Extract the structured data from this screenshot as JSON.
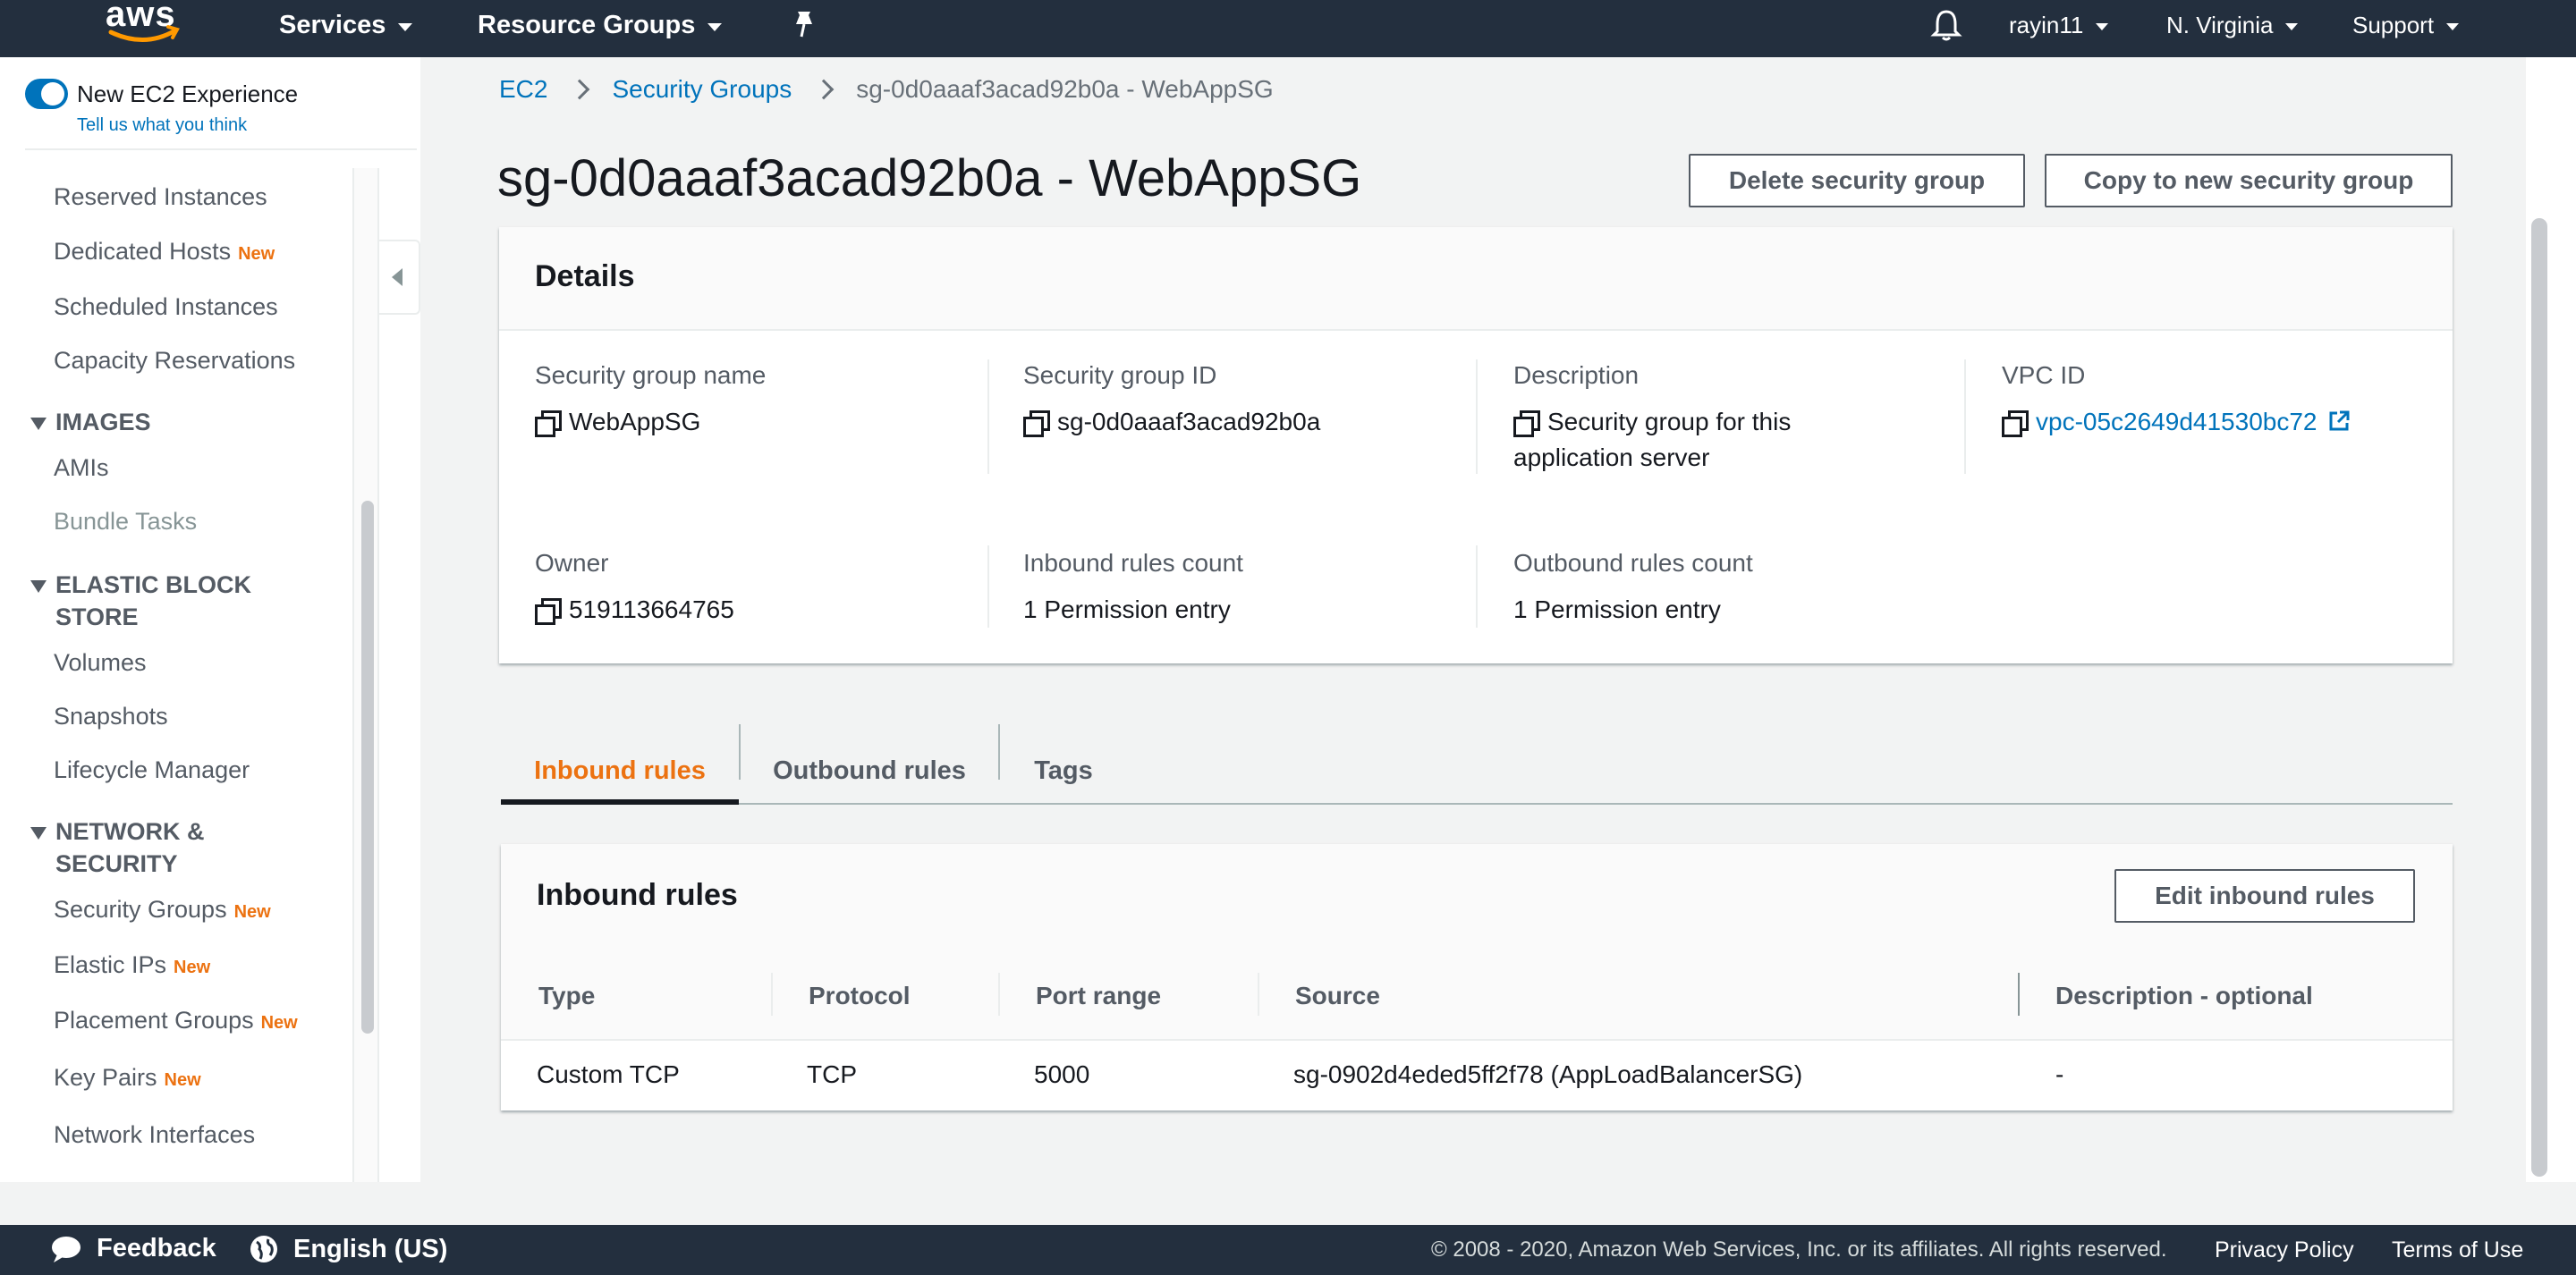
{
  "topnav": {
    "logo": "aws",
    "services": "Services",
    "resource_groups": "Resource Groups",
    "user": "rayin11",
    "region": "N. Virginia",
    "support": "Support"
  },
  "sidebar": {
    "experience_label": "New EC2 Experience",
    "experience_link": "Tell us what you think",
    "items_top": [
      {
        "label": "Reserved Instances",
        "badge": ""
      },
      {
        "label": "Dedicated Hosts",
        "badge": "New"
      },
      {
        "label": "Scheduled Instances",
        "badge": ""
      },
      {
        "label": "Capacity Reservations",
        "badge": ""
      }
    ],
    "section_images": "IMAGES",
    "images_items": [
      "AMIs",
      "Bundle Tasks"
    ],
    "section_ebs_line1": "ELASTIC BLOCK",
    "section_ebs_line2": "STORE",
    "ebs_items": [
      "Volumes",
      "Snapshots",
      "Lifecycle Manager"
    ],
    "section_net_line1": "NETWORK &",
    "section_net_line2": "SECURITY",
    "net_items": [
      {
        "label": "Security Groups",
        "badge": "New"
      },
      {
        "label": "Elastic IPs",
        "badge": "New"
      },
      {
        "label": "Placement Groups",
        "badge": "New"
      },
      {
        "label": "Key Pairs",
        "badge": "New"
      },
      {
        "label": "Network Interfaces",
        "badge": ""
      }
    ]
  },
  "breadcrumb": {
    "ec2": "EC2",
    "security_groups": "Security Groups",
    "current": "sg-0d0aaaf3acad92b0a - WebAppSG"
  },
  "page": {
    "title": "sg-0d0aaaf3acad92b0a - WebAppSG",
    "delete_button": "Delete security group",
    "copy_button": "Copy to new security group"
  },
  "details": {
    "title": "Details",
    "sg_name_label": "Security group name",
    "sg_name": "WebAppSG",
    "sg_id_label": "Security group ID",
    "sg_id": "sg-0d0aaaf3acad92b0a",
    "description_label": "Description",
    "description_line1": "Security group for this",
    "description_line2": "application server",
    "vpc_label": "VPC ID",
    "vpc_id": "vpc-05c2649d41530bc72",
    "owner_label": "Owner",
    "owner": "519113664765",
    "inbound_count_label": "Inbound rules count",
    "inbound_count": "1 Permission entry",
    "outbound_count_label": "Outbound rules count",
    "outbound_count": "1 Permission entry"
  },
  "tabs": [
    "Inbound rules",
    "Outbound rules",
    "Tags"
  ],
  "inbound": {
    "title": "Inbound rules",
    "edit_button": "Edit inbound rules",
    "columns": [
      "Type",
      "Protocol",
      "Port range",
      "Source",
      "Description - optional"
    ],
    "rows": [
      [
        "Custom TCP",
        "TCP",
        "5000",
        "sg-0902d4eded5ff2f78 (AppLoadBalancerSG)",
        "-"
      ]
    ]
  },
  "footer": {
    "feedback": "Feedback",
    "language": "English (US)",
    "copyright": "© 2008 - 2020, Amazon Web Services, Inc. or its affiliates. All rights reserved.",
    "privacy": "Privacy Policy",
    "terms": "Terms of Use"
  },
  "colors": {
    "nav_bg": "#232f3e",
    "link": "#0073bb",
    "accent_orange": "#ec7211"
  }
}
